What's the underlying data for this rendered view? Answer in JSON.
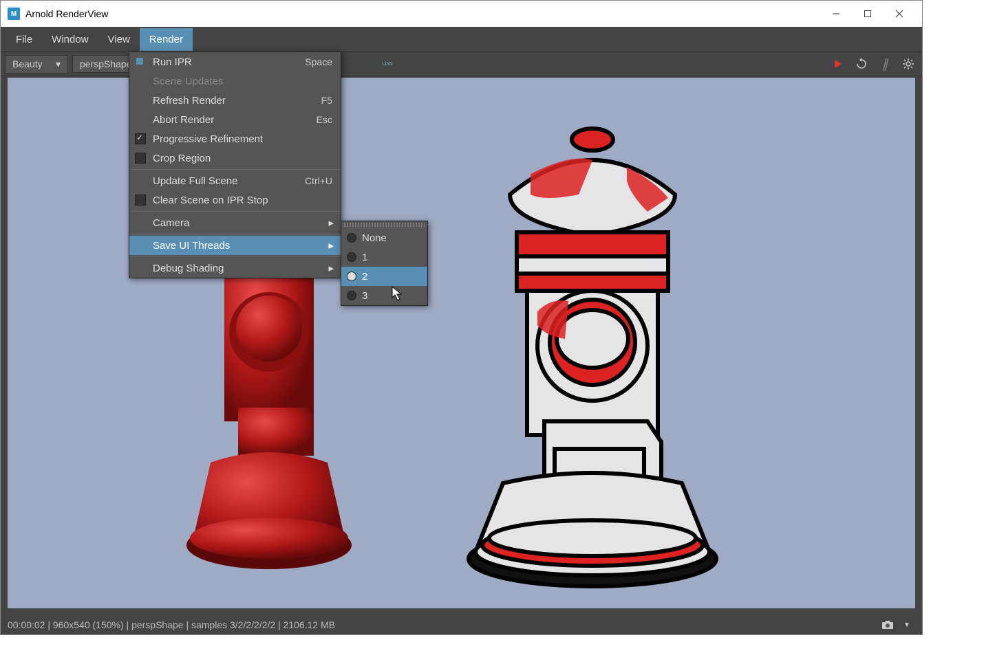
{
  "window": {
    "title": "Arnold RenderView",
    "app_icon_letter": "M"
  },
  "menubar": {
    "items": [
      {
        "label": "File"
      },
      {
        "label": "Window"
      },
      {
        "label": "View"
      },
      {
        "label": "Render"
      }
    ],
    "active_index": 3
  },
  "toolbar": {
    "aov_label": "Beauty",
    "camera_label": "perspShape",
    "log_label": "LOG"
  },
  "render_menu": {
    "items": [
      {
        "label": "Run IPR",
        "shortcut": "Space",
        "icon": true
      },
      {
        "label": "Scene Updates",
        "disabled": true
      },
      {
        "label": "Refresh Render",
        "shortcut": "F5"
      },
      {
        "label": "Abort Render",
        "shortcut": "Esc"
      },
      {
        "label": "Progressive Refinement",
        "checkbox": true,
        "checked": true
      },
      {
        "label": "Crop Region",
        "checkbox": true,
        "checked": false
      },
      {
        "sep": true
      },
      {
        "label": "Update Full Scene",
        "shortcut": "Ctrl+U"
      },
      {
        "label": "Clear Scene on IPR Stop",
        "checkbox": true,
        "checked": false
      },
      {
        "sep": true
      },
      {
        "label": "Camera",
        "submenu": true
      },
      {
        "sep": true
      },
      {
        "label": "Save UI Threads",
        "submenu": true,
        "highlighted": true
      },
      {
        "sep": true
      },
      {
        "label": "Debug Shading",
        "submenu": true
      }
    ]
  },
  "submenu_threads": {
    "items": [
      {
        "label": "None",
        "selected": false
      },
      {
        "label": "1",
        "selected": false
      },
      {
        "label": "2",
        "selected": true,
        "highlighted": true
      },
      {
        "label": "3",
        "selected": false
      }
    ]
  },
  "statusbar": {
    "text": "00:00:02 | 960x540 (150%) | perspShape  | samples 3/2/2/2/2/2 | 2106.12 MB"
  }
}
